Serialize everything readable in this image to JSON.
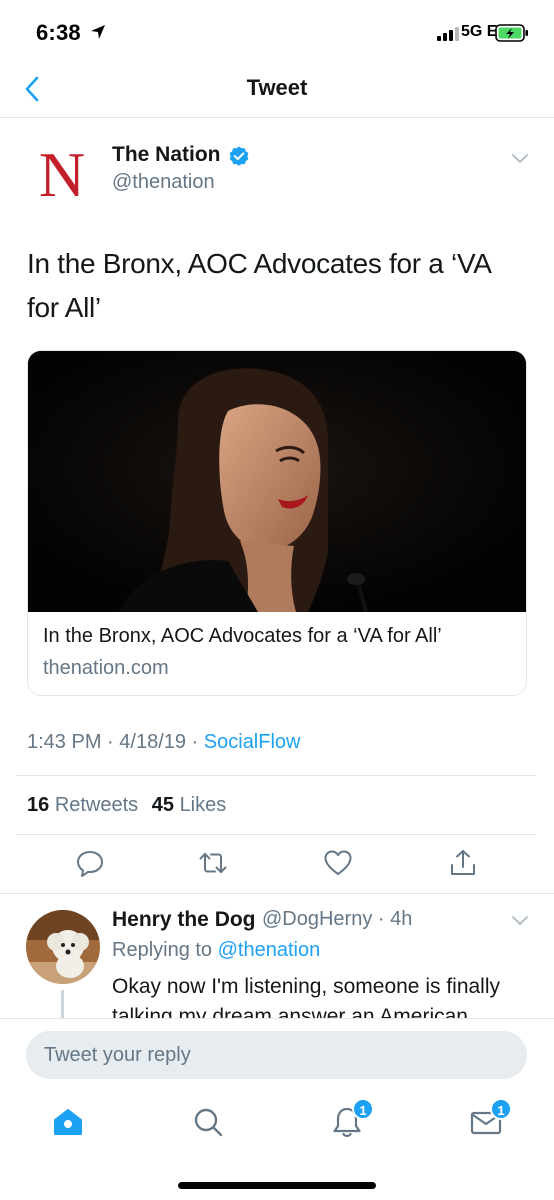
{
  "status_bar": {
    "time": "6:38",
    "network": "5G E"
  },
  "nav": {
    "title": "Tweet"
  },
  "tweet": {
    "author_name": "The Nation",
    "author_handle": "@thenation",
    "logo_letter": "N",
    "text": "In the Bronx, AOC Advocates for a ‘VA for All’",
    "card": {
      "title": "In the Bronx, AOC Advocates for a ‘VA for All’",
      "domain": "thenation.com"
    },
    "meta": {
      "time": "1:43 PM",
      "date": "4/18/19",
      "source": "SocialFlow"
    },
    "stats": {
      "retweets_count": "16",
      "retweets_label": "Retweets",
      "likes_count": "45",
      "likes_label": "Likes"
    }
  },
  "reply": {
    "author_name": "Henry the Dog",
    "author_handle": "@DogHerny",
    "age": "4h",
    "replying_label": "Replying to",
    "replying_to": "@thenation",
    "text": "Okay now I'm listening, someone is finally talking my dream answer an American"
  },
  "compose": {
    "placeholder": "Tweet your reply"
  },
  "tab_bar": {
    "notifications_badge": "1",
    "messages_badge": "1"
  },
  "colors": {
    "accent": "#1da1f2",
    "secondary_text": "#657786",
    "nation_red": "#c21f2a"
  }
}
